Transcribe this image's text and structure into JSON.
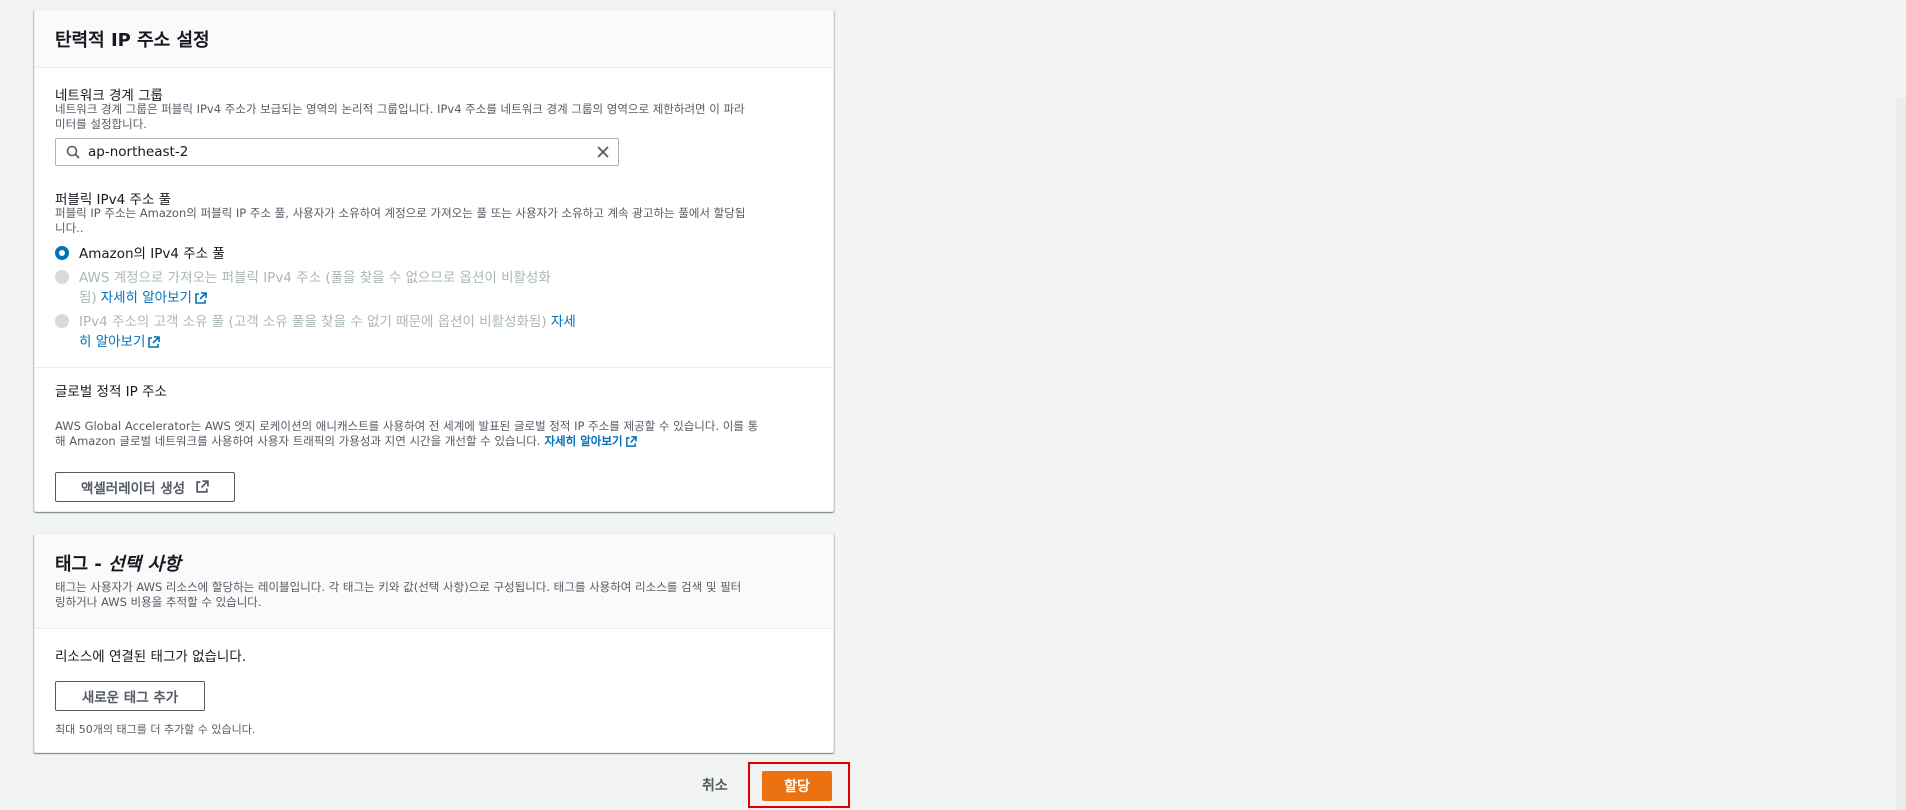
{
  "panel1": {
    "title": "탄력적 IP 주소 설정",
    "border_group": {
      "label": "네트워크 경계 그룹",
      "desc_line1": "네트워크 경계 그룹은 퍼블릭 IPv4 주소가 보급되는 영역의 논리적 그룹입니다. IPv4 주소를 네트워크 경계 그룹의 영역으로 제한하려면 이 파라",
      "desc_line2": "미터를 설정합니다.",
      "search_value": "ap-northeast-2"
    },
    "pool": {
      "label": "퍼블릭 IPv4 주소 풀",
      "desc_line1": "퍼블릭 IP 주소는 Amazon의 퍼블릭 IP 주소 풀, 사용자가 소유하여 계정으로 가져오는 풀 또는 사용자가 소유하고 계속 광고하는 풀에서 할당됩",
      "desc_line2": "니다..",
      "option1": "Amazon의 IPv4 주소 풀",
      "option2_line1": "AWS 계정으로 가져오는 퍼블릭 IPv4 주소 (풀을 찾을 수 없으므로 옵션이 비활성화",
      "option2_line2": "됨)",
      "option2_link": "자세히 알아보기",
      "option3_line1": "IPv4 주소의 고객 소유 풀 (고객 소유 풀을 찾을 수 없기 때문에 옵션이 비활성화됨)",
      "option3_link1": "자세",
      "option3_link2": "히 알아보기"
    },
    "global": {
      "label": "글로벌 정적 IP 주소",
      "desc_line1": "AWS Global Accelerator는 AWS 엣지 로케이션의 애니캐스트를 사용하여 전 세계에 발표된 글로벌 정적 IP 주소를 제공할 수 있습니다. 이를 통",
      "desc_line2": "해 Amazon 글로벌 네트워크를 사용하여 사용자 트래픽의 가용성과 지연 시간을 개선할 수 있습니다.",
      "link": "자세히 알아보기",
      "button": "액셀러레이터 생성"
    }
  },
  "panel2": {
    "title_main": "태그 - ",
    "title_italic": "선택 사항",
    "desc_line1": "태그는 사용자가 AWS 리소스에 할당하는 레이블입니다. 각 태그는 키와 값(선택 사항)으로 구성됩니다. 태그를 사용하여 리소스를 검색 및 필터",
    "desc_line2": "링하거나 AWS 비용을 추적할 수 있습니다.",
    "empty": "리소스에 연결된 태그가 없습니다.",
    "add_button": "새로운 태그 추가",
    "limit": "최대 50개의 태그를 더 추가할 수 있습니다."
  },
  "footer": {
    "cancel": "취소",
    "submit": "할당"
  },
  "colors": {
    "primary": "#ec7211",
    "link": "#0073bb",
    "highlight": "#e00000"
  },
  "icons": [
    "search-icon",
    "clear-icon",
    "external-link-icon"
  ]
}
